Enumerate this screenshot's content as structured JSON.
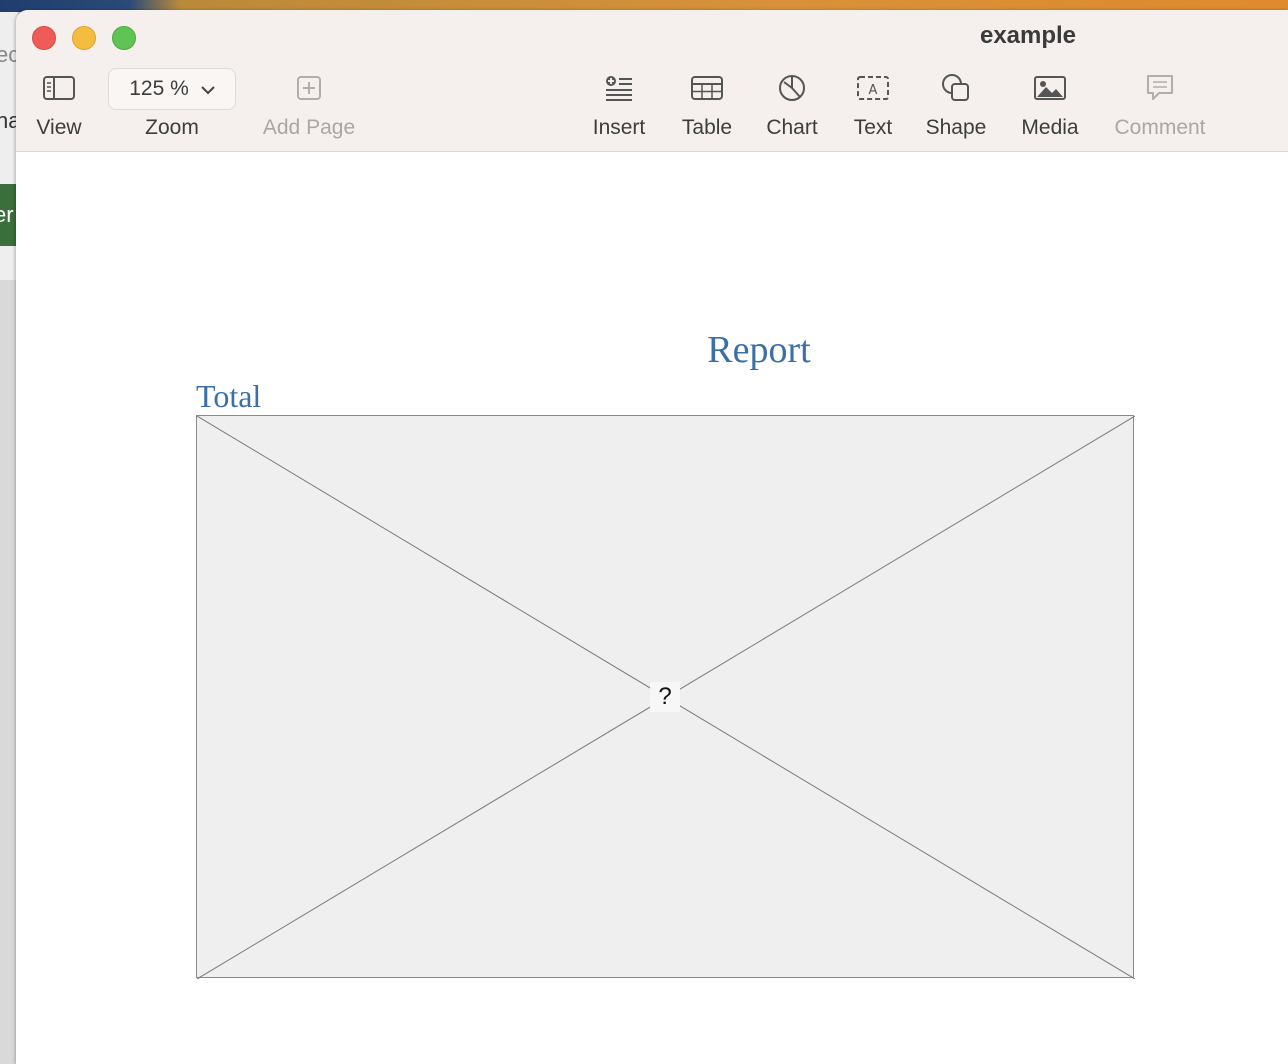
{
  "background": {
    "fragment_1": "ec",
    "fragment_2": "ha",
    "fragment_3": "er"
  },
  "window": {
    "title": "example"
  },
  "toolbar": {
    "view": "View",
    "zoom_label": "Zoom",
    "zoom_value": "125 %",
    "add_page": "Add Page",
    "insert": "Insert",
    "table": "Table",
    "chart": "Chart",
    "text": "Text",
    "shape": "Shape",
    "media": "Media",
    "comment": "Comment"
  },
  "document": {
    "heading": "Report",
    "subheading": "Total",
    "image_placeholder": "?"
  },
  "colors": {
    "heading": "#3b6fa8",
    "toolbar_bg": "#f5f0ed"
  }
}
